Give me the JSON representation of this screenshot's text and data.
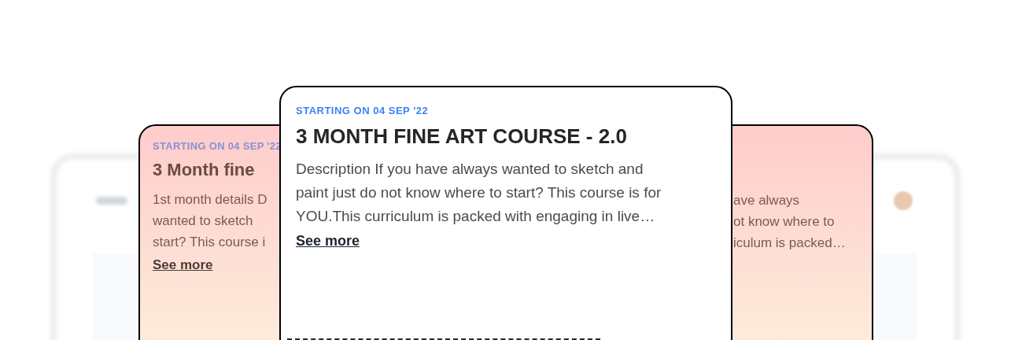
{
  "cards": [
    {
      "kind": "left",
      "start_label": "STARTING ON 04 SEP '22",
      "title": "3 Month fine",
      "description_lines": [
        "1st month details D",
        "wanted to sketch",
        "start? This course i"
      ],
      "link": "See more"
    },
    {
      "kind": "main",
      "start_label": "STARTING ON 04 SEP '22",
      "title": "3 MONTH FINE ART COURSE - 2.0",
      "description_lines": [
        "Description If you have always wanted to sketch and",
        "paint just do not know where to start? This course is for",
        "YOU.This curriculum is packed with engaging in live…"
      ],
      "link": "See more"
    },
    {
      "kind": "right",
      "description_lines": [
        "ave always",
        "ot know where to",
        "iculum is packed…"
      ]
    }
  ]
}
